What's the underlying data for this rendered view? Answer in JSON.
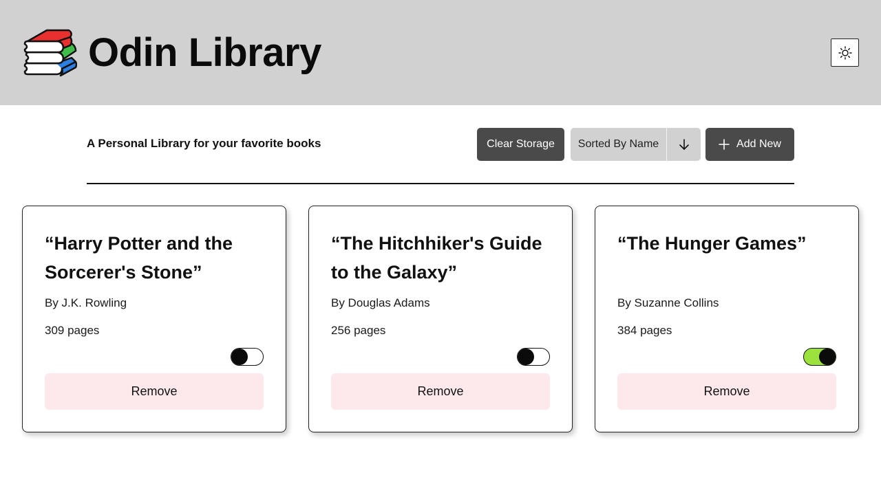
{
  "header": {
    "title": "Odin Library",
    "logo_icon": "stacked-books-icon",
    "theme_toggle_icon": "sun-icon"
  },
  "toolbar": {
    "tagline": "A Personal Library for your favorite books",
    "clear_label": "Clear Storage",
    "sort_label": "Sorted By Name",
    "sort_direction_icon": "arrow-down-icon",
    "add_label": "Add New",
    "add_icon": "plus-icon"
  },
  "books": [
    {
      "title": "“Harry Potter and the Sorcerer's Stone”",
      "author": "By J.K. Rowling",
      "pages": "309 pages",
      "read": false,
      "remove_label": "Remove"
    },
    {
      "title": "“The Hitchhiker's Guide to the Galaxy”",
      "author": "By Douglas Adams",
      "pages": "256 pages",
      "read": false,
      "remove_label": "Remove"
    },
    {
      "title": "“The Hunger Games”",
      "author": "By Suzanne Collins",
      "pages": "384 pages",
      "read": true,
      "remove_label": "Remove"
    }
  ],
  "colors": {
    "header_bg": "#d1d1d1",
    "dark_button": "#4a4a4a",
    "toggle_on": "#9be33c",
    "remove_bg": "#fde8ec"
  }
}
